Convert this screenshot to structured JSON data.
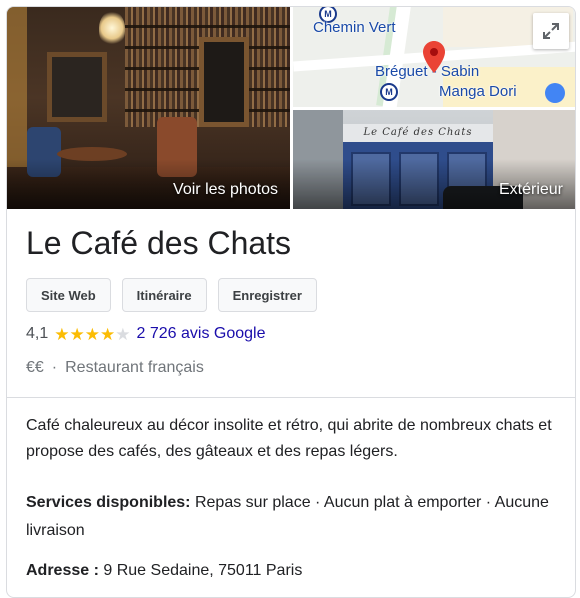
{
  "photos": {
    "main_caption": "Voir les photos",
    "exterior_caption": "Extérieur",
    "exterior_sign": "Le Café des Chats"
  },
  "map": {
    "labels": {
      "chemin_vert": "Chemin Vert",
      "breguet_sabin": "Bréguet - Sabin",
      "manga_dori": "Manga Dori"
    },
    "metro_symbol": "M",
    "expand_icon": "expand-icon"
  },
  "place": {
    "name": "Le Café des Chats",
    "actions": [
      "Site Web",
      "Itinéraire",
      "Enregistrer"
    ],
    "rating_value": "4,1",
    "rating_stars": 4.1,
    "reviews_text": "2 726 avis Google",
    "price": "€€",
    "separator": "·",
    "category": "Restaurant français",
    "description": "Café chaleureux au décor insolite et rétro, qui abrite de nombreux chats et propose des cafés, des gâteaux et des repas légers.",
    "services_label": "Services disponibles:",
    "services_value": "Repas sur place · Aucun plat à emporter · Aucune livraison",
    "address_label": "Adresse :",
    "address_value": "9 Rue Sedaine, 75011 Paris"
  },
  "colors": {
    "star": "#fbbc04",
    "link": "#1a0dab",
    "pin": "#ea4335",
    "metro": "#1a3a8c"
  }
}
